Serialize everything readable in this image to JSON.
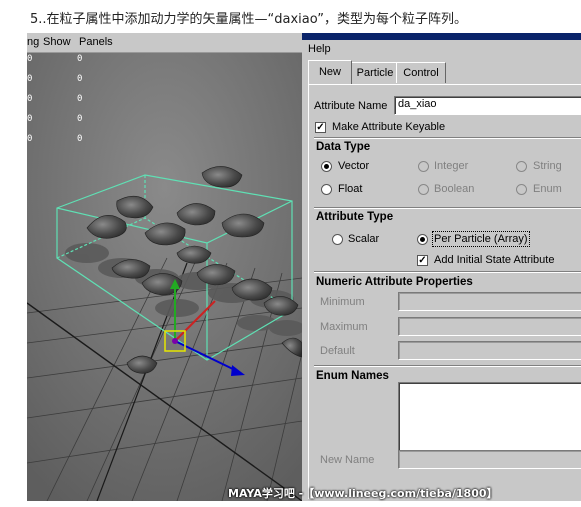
{
  "caption": "5..在粒子属性中添加动力学的矢量属性—“daxiao”，类型为每个粒子阵列。",
  "viewport": {
    "menu": [
      "ng",
      "Show",
      "Panels"
    ],
    "hud_left": [
      "0",
      "0",
      "0",
      "0",
      "0"
    ],
    "hud_right": [
      "0",
      "0",
      "0",
      "0",
      "0"
    ]
  },
  "dialog": {
    "menu_label": "Help",
    "tabs": [
      "New",
      "Particle",
      "Control"
    ],
    "active_tab": "New",
    "attribute_name_label": "Attribute Name",
    "attribute_name_value": "da_xiao",
    "make_keyable_label": "Make Attribute Keyable",
    "make_keyable_checked": true,
    "data_type": {
      "title": "Data Type",
      "options": [
        "Vector",
        "Integer",
        "String",
        "Float",
        "Boolean",
        "Enum"
      ],
      "selected": "Vector"
    },
    "attribute_type": {
      "title": "Attribute Type",
      "options": [
        "Scalar",
        "Per Particle (Array)"
      ],
      "selected": "Per Particle (Array)",
      "initial_state_label": "Add Initial State Attribute",
      "initial_state_checked": true
    },
    "numeric": {
      "title": "Numeric Attribute Properties",
      "minimum_label": "Minimum",
      "maximum_label": "Maximum",
      "default_label": "Default"
    },
    "enum": {
      "title": "Enum Names",
      "new_name_label": "New Name"
    }
  },
  "watermark": "MAYA学习吧 -【www.lineeg.com/tieba/1800】",
  "colors": {
    "viewport_bg": "#707070",
    "dialog_bg": "#c8c8c8",
    "bounding_box": "#5fe0b4",
    "grid": "#3a3a3a",
    "manipulator_x": "#0000cc",
    "manipulator_y": "#22aa22",
    "selection_box": "#e6e600"
  }
}
